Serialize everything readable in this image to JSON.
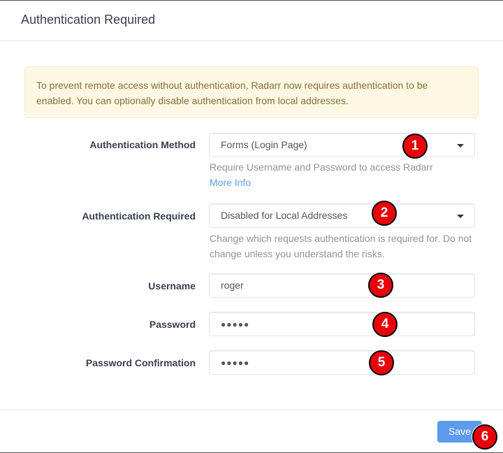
{
  "modal": {
    "title": "Authentication Required"
  },
  "alert": {
    "text": "To prevent remote access without authentication, Radarr now requires authentication to be enabled. You can optionally disable authentication from local addresses."
  },
  "auth_method": {
    "label": "Authentication Method",
    "value": "Forms (Login Page)",
    "help": "Require Username and Password to access Radarr",
    "more_info": "More Info"
  },
  "auth_required": {
    "label": "Authentication Required",
    "value": "Disabled for Local Addresses",
    "help": "Change which requests authentication is required for. Do not change unless you understand the risks."
  },
  "username": {
    "label": "Username",
    "value": "roger"
  },
  "password": {
    "label": "Password",
    "value": "●●●●●"
  },
  "password_confirmation": {
    "label": "Password Confirmation",
    "value": "●●●●●"
  },
  "footer": {
    "save_label": "Save"
  },
  "badges": [
    "1",
    "2",
    "3",
    "4",
    "5",
    "6"
  ],
  "colors": {
    "primary": "#5d9cec",
    "alert_bg": "#fcf8e3",
    "alert_text": "#8a6d3b",
    "badge": "#e8000b"
  }
}
